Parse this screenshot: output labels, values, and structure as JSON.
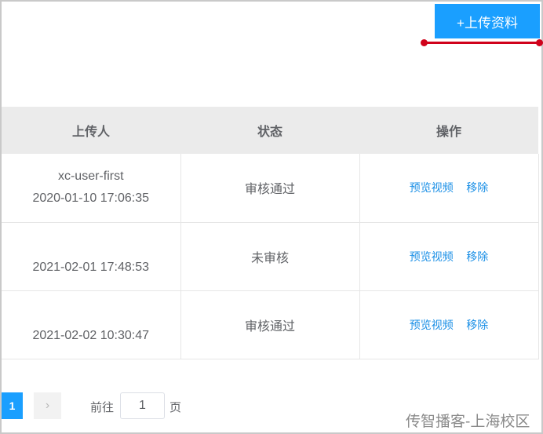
{
  "toolbar": {
    "upload_label": "+上传资料"
  },
  "table": {
    "headers": [
      "上传人",
      "状态",
      "操作"
    ],
    "rows": [
      {
        "uploader": "xc-user-first",
        "time": "2020-01-10 17:06:35",
        "status": "审核通过",
        "preview": "预览视频",
        "remove": "移除"
      },
      {
        "uploader": "",
        "time": "2021-02-01 17:48:53",
        "status": "未审核",
        "preview": "预览视频",
        "remove": "移除"
      },
      {
        "uploader": "",
        "time": "2021-02-02 10:30:47",
        "status": "审核通过",
        "preview": "预览视频",
        "remove": "移除"
      }
    ]
  },
  "pagination": {
    "current_page": "1",
    "next_symbol": "›",
    "goto_label": "前往",
    "goto_value": "1",
    "goto_suffix": "页"
  },
  "watermark": "传智播客-上海校区",
  "colors": {
    "accent": "#1a9fff",
    "link": "#1a8fe6",
    "annotation": "#d0021b"
  }
}
